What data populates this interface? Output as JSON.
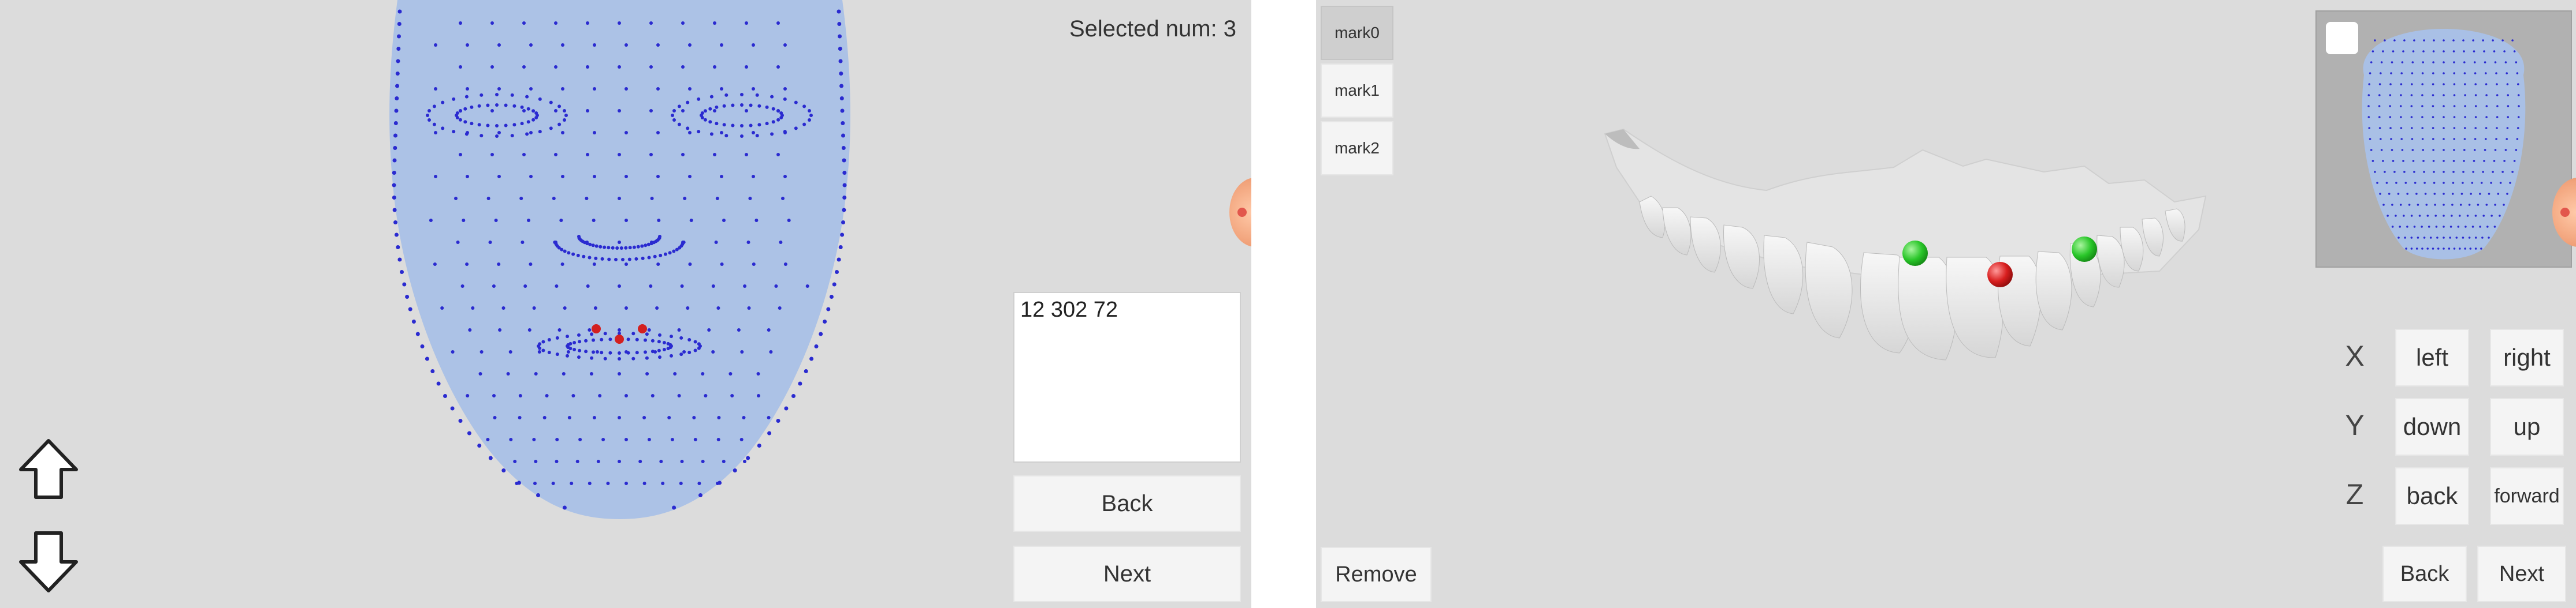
{
  "left": {
    "selected_num": "Selected num: 3",
    "selected_ids": "12 302 72",
    "back_label": "Back",
    "next_label": "Next",
    "icons": {
      "up": "arrow-up-icon",
      "down": "arrow-down-icon"
    }
  },
  "right": {
    "marks": [
      "mark0",
      "mark1",
      "mark2"
    ],
    "remove_label": "Remove",
    "axes": {
      "x": "X",
      "y": "Y",
      "z": "Z"
    },
    "controls": {
      "left": "left",
      "right": "right",
      "down": "down",
      "up": "up",
      "back": "back",
      "forward": "forward"
    },
    "back_label": "Back",
    "next_label": "Next"
  },
  "colors": {
    "panel_bg": "#dcdcdc",
    "face_mesh": "#a9c0e6",
    "landmark_point": "#2a2ad0",
    "selected_point": "#d32020",
    "marker_green": "#29c629",
    "marker_red": "#d81e1e"
  }
}
